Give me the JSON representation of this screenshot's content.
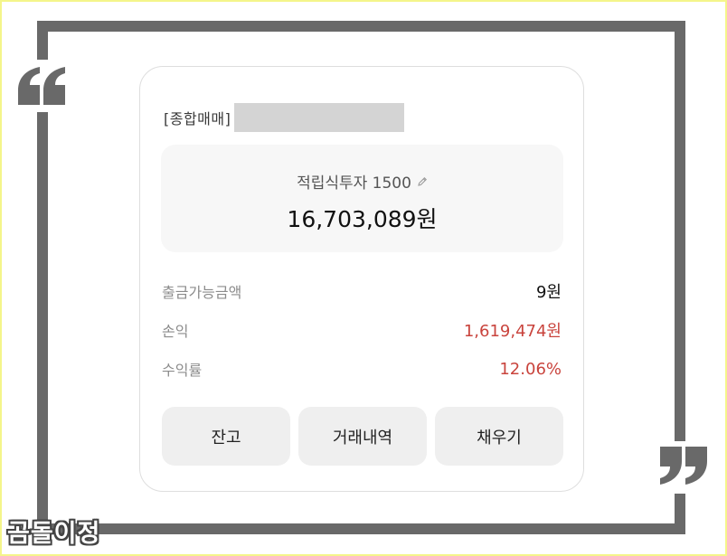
{
  "account": {
    "type_label": "[종합매매]"
  },
  "summary": {
    "product_name": "적립식투자 1500",
    "total_amount": "16,703,089원"
  },
  "details": [
    {
      "label": "출금가능금액",
      "value": "9원",
      "color": "#111111"
    },
    {
      "label": "손익",
      "value": "1,619,474원",
      "color": "#c9443d"
    },
    {
      "label": "수익률",
      "value": "12.06%",
      "color": "#c9443d"
    }
  ],
  "actions": {
    "balance_label": "잔고",
    "history_label": "거래내역",
    "fill_label": "채우기"
  },
  "watermark": "곰돌이정",
  "icons": {
    "edit": "pencil-icon",
    "quote_open": "open-quote-icon",
    "quote_close": "close-quote-icon"
  },
  "colors": {
    "frame": "#696969",
    "outer_border": "#f4f58a",
    "positive": "#c9443d",
    "button_bg": "#efefef",
    "summary_bg": "#f7f7f7"
  }
}
